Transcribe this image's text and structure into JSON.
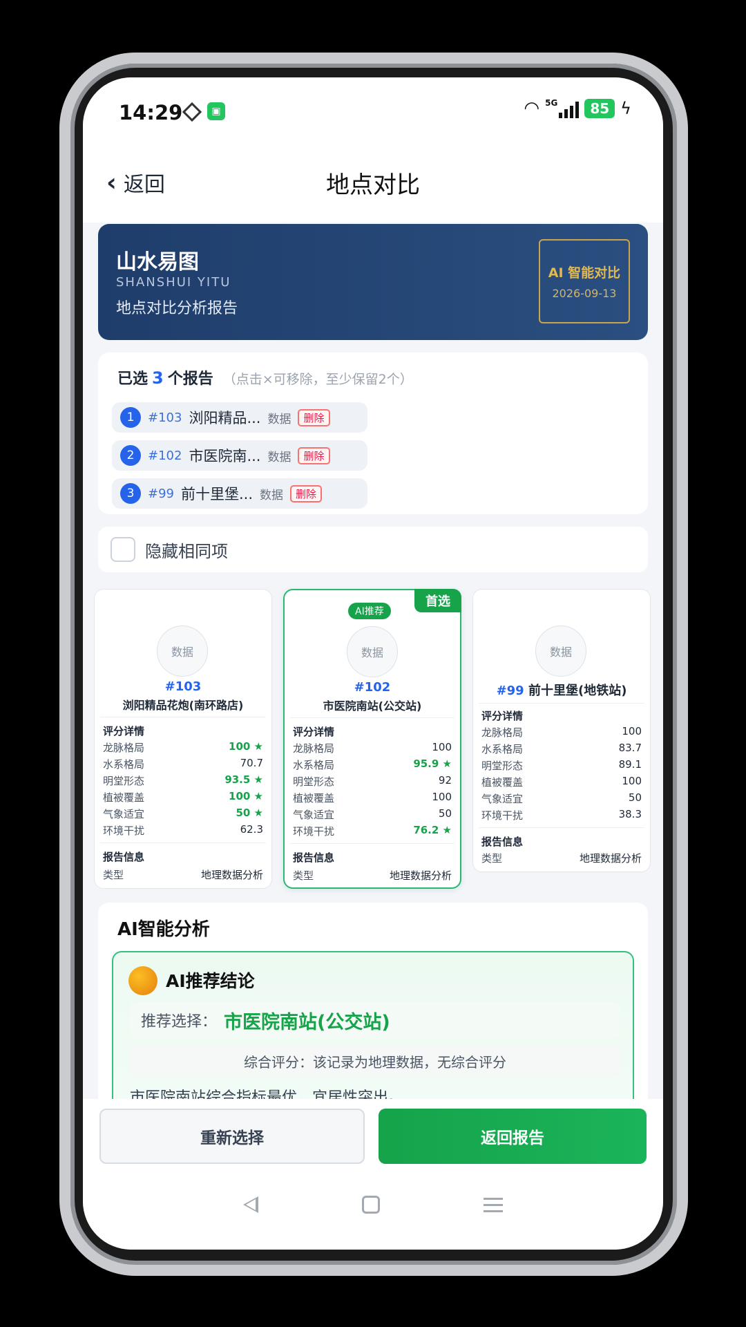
{
  "status": {
    "time": "14:29",
    "network": "5G",
    "battery": "85"
  },
  "nav": {
    "back_label": "返回",
    "title": "地点对比"
  },
  "hero": {
    "title": "山水易图",
    "subtitle_en": "SHANSHUI YITU",
    "subtitle": "地点对比分析报告",
    "stamp_title": "AI 智能对比",
    "stamp_date": "2026-09-13"
  },
  "selected": {
    "prefix": "已选",
    "count": "3",
    "suffix": "个报告",
    "hint": "（点击×可移除，至少保留2个）",
    "items": [
      {
        "index": "1",
        "id": "#103",
        "name": "浏阳精品...",
        "tag": "数据",
        "delete": "删除"
      },
      {
        "index": "2",
        "id": "#102",
        "name": "市医院南...",
        "tag": "数据",
        "delete": "删除"
      },
      {
        "index": "3",
        "id": "#99",
        "name": "前十里堡...",
        "tag": "数据",
        "delete": "删除"
      }
    ]
  },
  "hide_same": {
    "label": "隐藏相同项",
    "checked": false
  },
  "compare": [
    {
      "avatar": "数据",
      "id": "#103",
      "name": "浏阳精品花炮(南环路店)",
      "score_section": "评分详情",
      "scores": [
        {
          "label": "龙脉格局",
          "value": "100 ★",
          "best": true
        },
        {
          "label": "水系格局",
          "value": "70.7",
          "best": false
        },
        {
          "label": "明堂形态",
          "value": "93.5 ★",
          "best": true
        },
        {
          "label": "植被覆盖",
          "value": "100 ★",
          "best": true
        },
        {
          "label": "气象适宜",
          "value": "50 ★",
          "best": true
        },
        {
          "label": "环境干扰",
          "value": "62.3",
          "best": false
        }
      ],
      "info_section": "报告信息",
      "info": {
        "label": "类型",
        "value": "地理数据分析"
      }
    },
    {
      "badge_top": "首选",
      "badge_ai": "AI推荐",
      "avatar": "数据",
      "id": "#102",
      "name": "市医院南站(公交站)",
      "score_section": "评分详情",
      "scores": [
        {
          "label": "龙脉格局",
          "value": "100",
          "best": false
        },
        {
          "label": "水系格局",
          "value": "95.9 ★",
          "best": true
        },
        {
          "label": "明堂形态",
          "value": "92",
          "best": false
        },
        {
          "label": "植被覆盖",
          "value": "100",
          "best": false
        },
        {
          "label": "气象适宜",
          "value": "50",
          "best": false
        },
        {
          "label": "环境干扰",
          "value": "76.2 ★",
          "best": true
        }
      ],
      "info_section": "报告信息",
      "info": {
        "label": "类型",
        "value": "地理数据分析"
      }
    },
    {
      "avatar": "数据",
      "id": "#99",
      "name": "前十里堡(地铁站)",
      "score_section": "评分详情",
      "scores": [
        {
          "label": "龙脉格局",
          "value": "100",
          "best": false
        },
        {
          "label": "水系格局",
          "value": "83.7",
          "best": false
        },
        {
          "label": "明堂形态",
          "value": "89.1",
          "best": false
        },
        {
          "label": "植被覆盖",
          "value": "100",
          "best": false
        },
        {
          "label": "气象适宜",
          "value": "50",
          "best": false
        },
        {
          "label": "环境干扰",
          "value": "38.3",
          "best": false
        }
      ],
      "info_section": "报告信息",
      "info": {
        "label": "类型",
        "value": "地理数据分析"
      }
    }
  ],
  "ai": {
    "title": "AI智能分析",
    "conclusion_title": "AI推荐结论",
    "recommend_label": "推荐选择：",
    "recommend_value": "市医院南站(公交站)",
    "score_text": "综合评分：该记录为地理数据，无综合评分",
    "analysis_text": "市医院南站综合指标最优，宜居性突出。"
  },
  "actions": {
    "reselect": "重新选择",
    "back_report": "返回报告"
  },
  "colors": {
    "primary_green": "#16a34a",
    "accent_blue": "#2563eb",
    "hero_bg": "#1f3d6b",
    "stamp_gold": "#e2b84f",
    "delete_red": "#e11d48"
  }
}
